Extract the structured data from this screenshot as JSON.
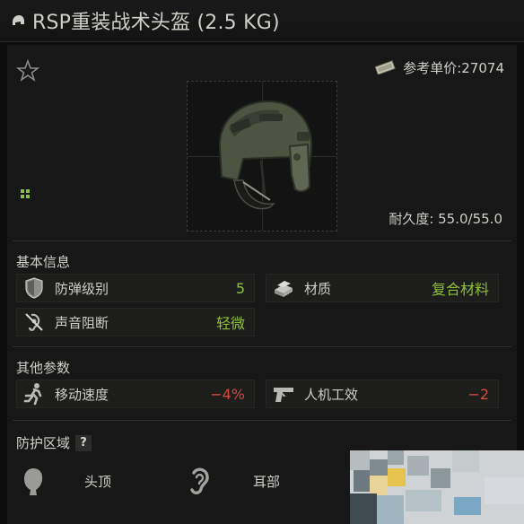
{
  "window": {
    "title": "RSP重装战术头盔 (2.5 KG)",
    "title_icon": "helmet-icon"
  },
  "header": {
    "favorite_icon": "star-icon",
    "price_icon": "money-icon",
    "price_label": "参考单价:27074"
  },
  "item": {
    "image": "helmet-image",
    "durability_label": "耐久度: 55.0/55.0"
  },
  "basic_info": {
    "title": "基本信息",
    "stats": [
      {
        "icon": "armor-shield-icon",
        "label": "防弹级别",
        "value": "5",
        "color": "#8fbf3a"
      },
      {
        "icon": "material-icon",
        "label": "材质",
        "value": "复合材料",
        "color": "#8fbf3a"
      },
      {
        "icon": "sound-block-icon",
        "label": "声音阻断",
        "value": "轻微",
        "color": "#8fbf3a"
      }
    ]
  },
  "other_params": {
    "title": "其他参数",
    "stats": [
      {
        "icon": "running-icon",
        "label": "移动速度",
        "value": "−4%",
        "color": "#d24b3e"
      },
      {
        "icon": "pistol-icon",
        "label": "人机工效",
        "value": "−2",
        "color": "#d24b3e"
      }
    ]
  },
  "protection": {
    "title": "防护区域",
    "help": "?",
    "zones": [
      {
        "icon": "head-top-icon",
        "label": "头顶"
      },
      {
        "icon": "ear-icon",
        "label": "耳部"
      }
    ]
  },
  "colors": {
    "positive": "#8fbf3a",
    "negative": "#d24b3e",
    "background": "#0b0c0b",
    "panel": "#161716"
  }
}
